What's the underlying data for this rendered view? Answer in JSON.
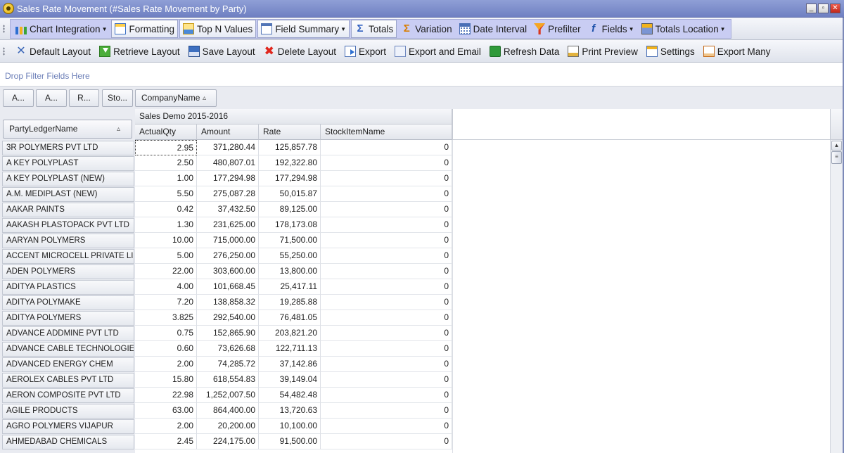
{
  "window": {
    "title": "Sales Rate Movement (#Sales Rate Movement by Party)",
    "controls": {
      "minimize": "_",
      "restore": "▫",
      "close": "✕"
    }
  },
  "toolbar1": [
    {
      "label": "Chart Integration",
      "icon": "chart-icon",
      "dropdown": true
    },
    {
      "label": "Formatting",
      "icon": "formatting-icon",
      "dropdown": false
    },
    {
      "label": "Top N Values",
      "icon": "top-n-icon",
      "dropdown": false
    },
    {
      "label": "Field Summary",
      "icon": "field-summary-icon",
      "dropdown": true
    },
    {
      "label": "Totals",
      "icon": "sigma-icon",
      "dropdown": false
    },
    {
      "label": "Variation",
      "icon": "variation-icon",
      "dropdown": false
    },
    {
      "label": "Date Interval",
      "icon": "calendar-icon",
      "dropdown": false
    },
    {
      "label": "Prefilter",
      "icon": "prefilter-icon",
      "dropdown": false
    },
    {
      "label": "Fields",
      "icon": "fields-icon",
      "dropdown": true
    },
    {
      "label": "Totals Location",
      "icon": "totals-location-icon",
      "dropdown": true
    }
  ],
  "toolbar2": [
    {
      "label": "Default Layout",
      "icon": "default-layout-icon"
    },
    {
      "label": "Retrieve Layout",
      "icon": "retrieve-layout-icon"
    },
    {
      "label": "Save Layout",
      "icon": "save-icon"
    },
    {
      "label": "Delete Layout",
      "icon": "delete-icon"
    },
    {
      "label": "Export",
      "icon": "export-icon"
    },
    {
      "label": "Export and Email",
      "icon": "email-icon"
    },
    {
      "label": "Refresh Data",
      "icon": "refresh-icon"
    },
    {
      "label": "Print Preview",
      "icon": "print-preview-icon"
    },
    {
      "label": "Settings",
      "icon": "settings-icon"
    },
    {
      "label": "Export Many",
      "icon": "export-many-icon"
    }
  ],
  "filter_area": {
    "placeholder": "Drop Filter Fields Here"
  },
  "data_fields": [
    "A...",
    "A...",
    "R...",
    "Sto..."
  ],
  "column_field": {
    "label": "CompanyName",
    "sort": "▵"
  },
  "row_field": {
    "label": "PartyLedgerName",
    "sort": "▵"
  },
  "column_group": "Sales Demo 2015-2016",
  "columns": [
    "ActualQty",
    "Amount",
    "Rate",
    "StockItemName"
  ],
  "rows": [
    {
      "name": "3R POLYMERS PVT LTD",
      "qty": "2.95",
      "amount": "371,280.44",
      "rate": "125,857.78",
      "stock": "0"
    },
    {
      "name": "A KEY POLYPLAST",
      "qty": "2.50",
      "amount": "480,807.01",
      "rate": "192,322.80",
      "stock": "0"
    },
    {
      "name": "A KEY POLYPLAST (NEW)",
      "qty": "1.00",
      "amount": "177,294.98",
      "rate": "177,294.98",
      "stock": "0"
    },
    {
      "name": "A.M. MEDIPLAST (NEW)",
      "qty": "5.50",
      "amount": "275,087.28",
      "rate": "50,015.87",
      "stock": "0"
    },
    {
      "name": "AAKAR PAINTS",
      "qty": "0.42",
      "amount": "37,432.50",
      "rate": "89,125.00",
      "stock": "0"
    },
    {
      "name": "AAKASH PLASTOPACK PVT LTD",
      "qty": "1.30",
      "amount": "231,625.00",
      "rate": "178,173.08",
      "stock": "0"
    },
    {
      "name": "AARYAN POLYMERS",
      "qty": "10.00",
      "amount": "715,000.00",
      "rate": "71,500.00",
      "stock": "0"
    },
    {
      "name": "ACCENT MICROCELL PRIVATE LI...",
      "qty": "5.00",
      "amount": "276,250.00",
      "rate": "55,250.00",
      "stock": "0"
    },
    {
      "name": "ADEN POLYMERS",
      "qty": "22.00",
      "amount": "303,600.00",
      "rate": "13,800.00",
      "stock": "0"
    },
    {
      "name": "ADITYA PLASTICS",
      "qty": "4.00",
      "amount": "101,668.45",
      "rate": "25,417.11",
      "stock": "0"
    },
    {
      "name": "ADITYA POLYMAKE",
      "qty": "7.20",
      "amount": "138,858.32",
      "rate": "19,285.88",
      "stock": "0"
    },
    {
      "name": "ADITYA POLYMERS",
      "qty": "3.825",
      "amount": "292,540.00",
      "rate": "76,481.05",
      "stock": "0"
    },
    {
      "name": "ADVANCE ADDMINE PVT LTD",
      "qty": "0.75",
      "amount": "152,865.90",
      "rate": "203,821.20",
      "stock": "0"
    },
    {
      "name": "ADVANCE CABLE TECHNOLOGIES ...",
      "qty": "0.60",
      "amount": "73,626.68",
      "rate": "122,711.13",
      "stock": "0"
    },
    {
      "name": "ADVANCED ENERGY CHEM",
      "qty": "2.00",
      "amount": "74,285.72",
      "rate": "37,142.86",
      "stock": "0"
    },
    {
      "name": "AEROLEX CABLES PVT LTD",
      "qty": "15.80",
      "amount": "618,554.83",
      "rate": "39,149.04",
      "stock": "0"
    },
    {
      "name": "AERON COMPOSITE PVT LTD",
      "qty": "22.98",
      "amount": "1,252,007.50",
      "rate": "54,482.48",
      "stock": "0"
    },
    {
      "name": "AGILE PRODUCTS",
      "qty": "63.00",
      "amount": "864,400.00",
      "rate": "13,720.63",
      "stock": "0"
    },
    {
      "name": "AGRO POLYMERS  VIJAPUR",
      "qty": "2.00",
      "amount": "20,200.00",
      "rate": "10,100.00",
      "stock": "0"
    },
    {
      "name": "AHMEDABAD CHEMICALS",
      "qty": "2.45",
      "amount": "224,175.00",
      "rate": "91,500.00",
      "stock": "0"
    }
  ],
  "scrollbar": {
    "up": "▲",
    "thumb": "≡"
  }
}
